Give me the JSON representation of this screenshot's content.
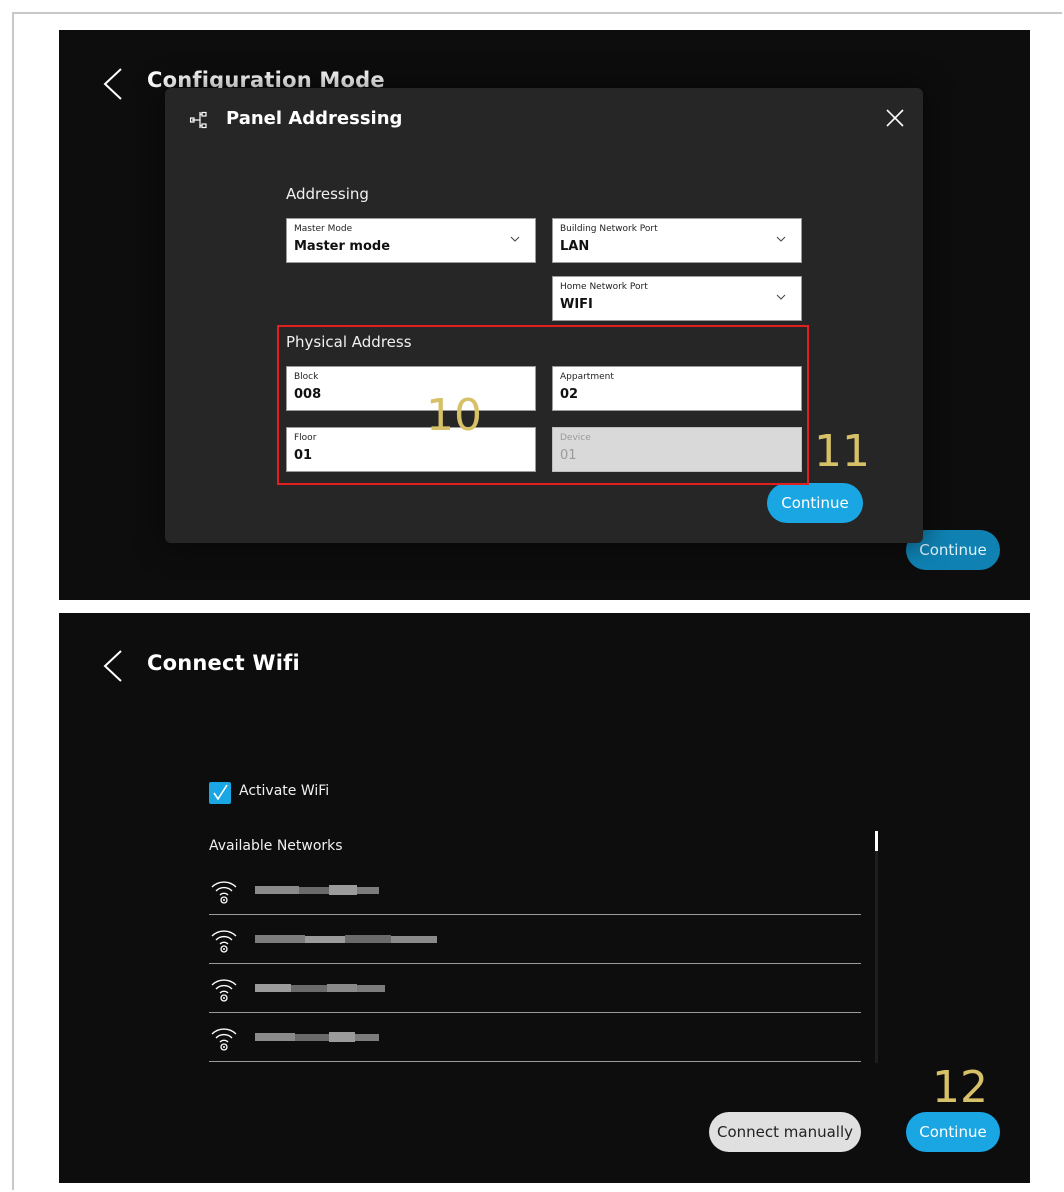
{
  "screen1": {
    "title": "Configuration Mode",
    "background_continue": "Continue",
    "dialog": {
      "title": "Panel Addressing",
      "addressing_label": "Addressing",
      "master_mode": {
        "label": "Master Mode",
        "value": "Master mode"
      },
      "building_port": {
        "label": "Building Network Port",
        "value": "LAN"
      },
      "home_port": {
        "label": "Home Network Port",
        "value": "WIFI"
      },
      "physical_address_label": "Physical Address",
      "block": {
        "label": "Block",
        "value": "008"
      },
      "appartment": {
        "label": "Appartment",
        "value": "02"
      },
      "floor": {
        "label": "Floor",
        "value": "01"
      },
      "device": {
        "label": "Device",
        "value": "01"
      },
      "continue": "Continue"
    }
  },
  "markers": {
    "m10": "10",
    "m11": "11",
    "m12": "12"
  },
  "screen2": {
    "title": "Connect Wifi",
    "activate_wifi": "Activate WiFi",
    "activate_checked": true,
    "available_networks": "Available Networks",
    "networks_visible_count": 4,
    "connect_manually": "Connect manually",
    "continue": "Continue"
  },
  "colors": {
    "accent": "#1aa6e3",
    "highlight": "#e21f1f",
    "marker": "#d7c168",
    "background": "#0d0d0d",
    "dialog": "#262626"
  },
  "icons": [
    "back-arrow-icon",
    "panel-addressing-icon",
    "close-icon",
    "chevron-down-icon",
    "checkmark-icon",
    "wifi-icon"
  ]
}
